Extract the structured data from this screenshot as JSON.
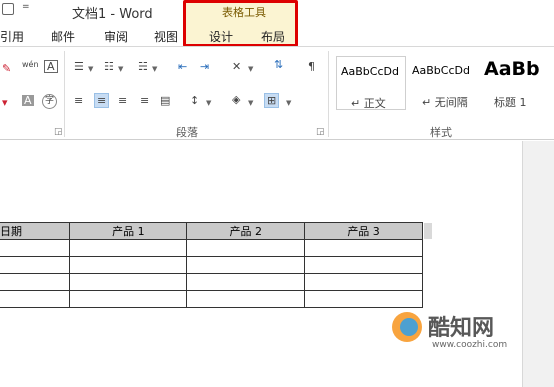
{
  "window": {
    "title": "文档1 - Word",
    "qat_dropdown": "="
  },
  "context_tabs": {
    "label": "表格工具",
    "tabs": [
      "设计",
      "布局"
    ]
  },
  "tabs": [
    "引用",
    "邮件",
    "审阅",
    "视图"
  ],
  "ribbon": {
    "font_icons": [
      "aA",
      "wén",
      "A",
      "A",
      "字"
    ],
    "paragraph_label": "段落",
    "styles_label": "样式",
    "styles": [
      {
        "sample": "AaBbCcDd",
        "name": "↵ 正文"
      },
      {
        "sample": "AaBbCcDd",
        "name": "↵ 无间隔"
      },
      {
        "sample": "AaBb",
        "name": "标题 1"
      }
    ]
  },
  "table": {
    "headers": [
      "日期",
      "产品 1",
      "产品 2",
      "产品 3"
    ],
    "rows": [
      [
        "",
        "",
        "",
        ""
      ],
      [
        "",
        "",
        "",
        ""
      ],
      [
        "",
        "",
        "",
        ""
      ],
      [
        "",
        "",
        "",
        ""
      ]
    ]
  },
  "watermark": {
    "text": "酷知网",
    "url": "www.coozhi.com"
  },
  "colors": {
    "accent": "#2a6ebb",
    "highlight_box": "#d00000",
    "context_bg": "#fbf4d2"
  }
}
